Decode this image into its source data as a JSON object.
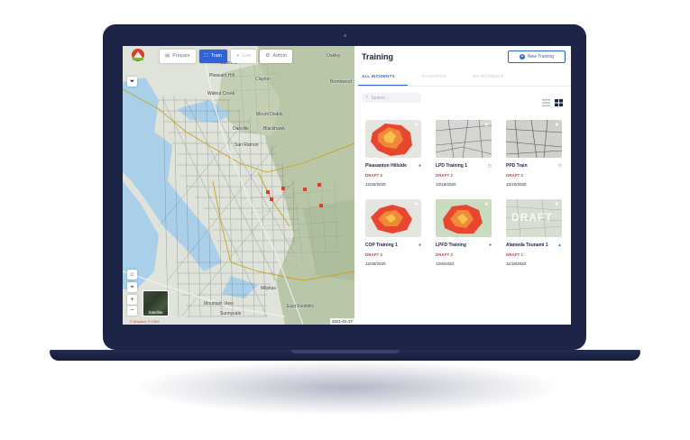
{
  "map": {
    "modes": [
      {
        "label": "Prepare",
        "icon": "clipboard-icon",
        "active": false
      },
      {
        "label": "Train",
        "icon": "expand-icon",
        "active": true
      },
      {
        "label": "Live",
        "icon": "live-dot-icon",
        "active": false
      },
      {
        "label": "Admin",
        "icon": "gear-icon",
        "active": false
      }
    ],
    "place_labels": [
      "Concord",
      "Pleasant Hill",
      "Clayton",
      "Walnut Creek",
      "Mount Diablo",
      "Danville",
      "Blackhawk",
      "San Ramon",
      "Brentwood",
      "Oakley",
      "Milpitas",
      "Mountain View",
      "Sunnyvale",
      "East Foothills"
    ],
    "satellite_label": "Satellite",
    "date_tag": "2021-01-27",
    "attribution": "© Mapbox © OSM",
    "colors": {
      "water": "#a9cfe9",
      "land": "#dfe3d9",
      "terrain": "#b7c4a6",
      "county_line": "#c9a21a",
      "roads": "#5f6670",
      "incident": "#e23b2e"
    }
  },
  "panel": {
    "title": "Training",
    "new_button": "New Training",
    "tabs": [
      "ALL INCIDENTS",
      "FAVORITES",
      "MY INCIDENTS"
    ],
    "search_placeholder": "Search...",
    "cards": [
      {
        "name": "Pleasanton Hillside",
        "status": "DRAFT 2",
        "date": "12/25/2020",
        "thumb": "fire",
        "type_icon": "fire-drop-icon"
      },
      {
        "name": "LPD Training 1",
        "status": "DRAFT 2",
        "date": "12/18/2020",
        "thumb": "map",
        "type_icon": "clock-icon"
      },
      {
        "name": "PPD Train",
        "status": "DRAFT 2",
        "date": "12/10/2020",
        "thumb": "map",
        "type_icon": "clock-icon"
      },
      {
        "name": "COP Training 1",
        "status": "DRAFT 2",
        "date": "12/30/2020",
        "thumb": "fire",
        "type_icon": "fire-drop-icon"
      },
      {
        "name": "LPFD Training",
        "status": "DRAFT 2",
        "date": "12/9/2020",
        "thumb": "fire-green",
        "type_icon": "fire-drop-icon"
      },
      {
        "name": "Alameda Tsunami 1",
        "status": "DRAFT 1",
        "date": "11/18/2020",
        "thumb": "draft",
        "type_icon": "water-icon",
        "thumb_text": "DRAFT"
      }
    ]
  }
}
